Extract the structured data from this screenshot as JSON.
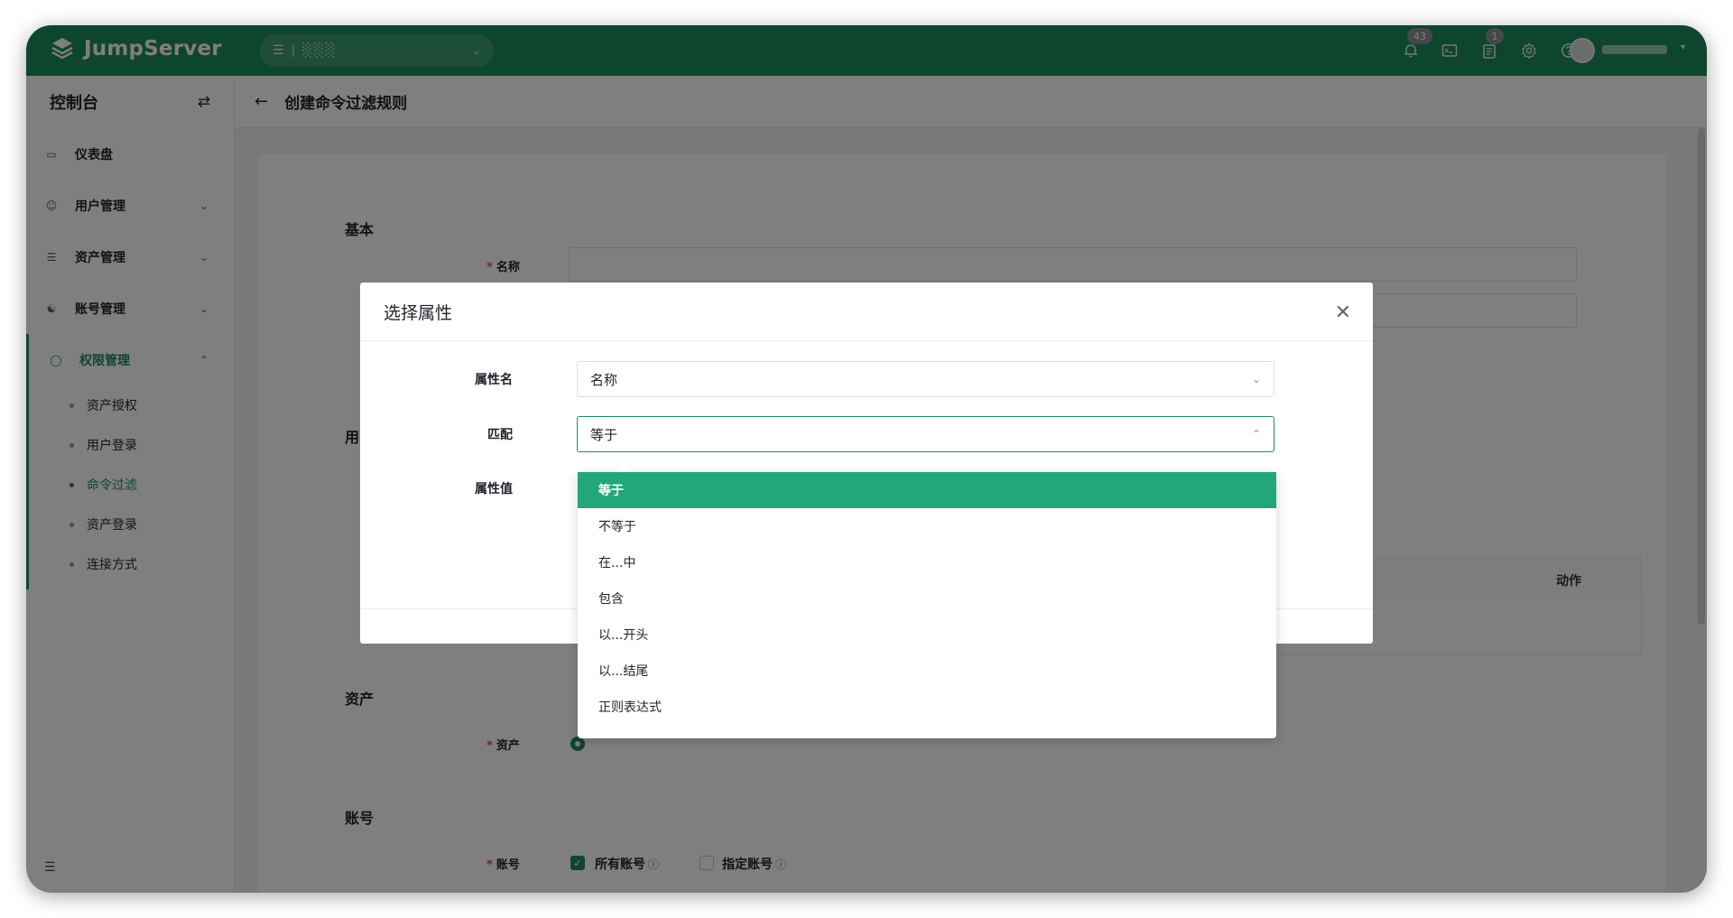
{
  "brand": {
    "name": "JumpServer",
    "accent": "#1c8a5f",
    "select_highlight": "#22a67a"
  },
  "topbar": {
    "org_icon": "org-icon",
    "org_separator": "|",
    "org_name": "░░░",
    "notification_count": "43",
    "tickets_count": "1",
    "icons": [
      "bell-icon",
      "terminal-icon",
      "clipboard-icon",
      "gear-icon",
      "help-icon"
    ]
  },
  "sidebar": {
    "title": "控制台",
    "items": [
      {
        "label": "仪表盘",
        "icon": "dashboard-icon"
      },
      {
        "label": "用户管理",
        "icon": "users-icon"
      },
      {
        "label": "资产管理",
        "icon": "database-icon"
      },
      {
        "label": "账号管理",
        "icon": "accounts-icon"
      },
      {
        "label": "权限管理",
        "icon": "shield-icon"
      }
    ],
    "subitems": [
      "资产授权",
      "用户登录",
      "命令过滤",
      "资产登录",
      "连接方式"
    ]
  },
  "page": {
    "title": "创建命令过滤规则",
    "sections": {
      "basic": "基本",
      "user": "用",
      "asset": "资产",
      "account": "账号"
    },
    "fields": {
      "name": "名称",
      "asset": "资产",
      "account": "账号"
    },
    "table_header_action": "动作",
    "account_options": [
      "所有账号",
      "指定账号"
    ]
  },
  "dialog": {
    "title": "选择属性",
    "labels": {
      "attr_name": "属性名",
      "match": "匹配",
      "attr_value": "属性值"
    },
    "attr_name_value": "名称",
    "match_value": "等于"
  },
  "dropdown": {
    "options": [
      "等于",
      "不等于",
      "在...中",
      "包含",
      "以...开头",
      "以...结尾",
      "正则表达式"
    ],
    "selected_index": 0
  }
}
